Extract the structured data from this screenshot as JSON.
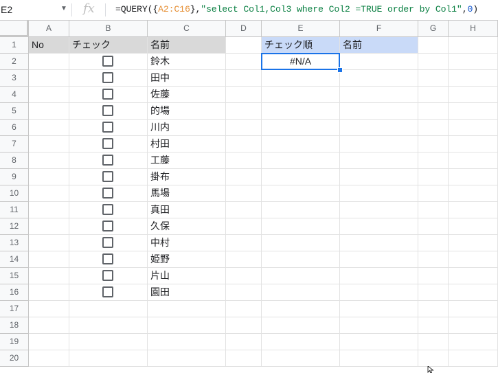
{
  "formula_bar": {
    "name_box": "E2",
    "fx_label": "fx",
    "formula": {
      "prefix": "=QUERY({",
      "range": "A2:C16",
      "mid": "},",
      "query": "\"select Col1,Col3 where Col2 =TRUE order by Col1\"",
      "comma": ",",
      "headers_arg": "0",
      "suffix": ")"
    }
  },
  "columns": [
    "A",
    "B",
    "C",
    "D",
    "E",
    "F",
    "G",
    "H"
  ],
  "rows": [
    "1",
    "2",
    "3",
    "4",
    "5",
    "6",
    "7",
    "8",
    "9",
    "10",
    "11",
    "12",
    "13",
    "14",
    "15",
    "16",
    "17",
    "18",
    "19",
    "20"
  ],
  "header_row": {
    "a1": "No",
    "b1": "チェック",
    "c1": "名前",
    "e1": "チェック順",
    "f1": "名前"
  },
  "names": [
    "鈴木",
    "田中",
    "佐藤",
    "的場",
    "川内",
    "村田",
    "工藤",
    "掛布",
    "馬場",
    "真田",
    "久保",
    "中村",
    "姫野",
    "片山",
    "園田"
  ],
  "checkboxes": [
    false,
    false,
    false,
    false,
    false,
    false,
    false,
    false,
    false,
    false,
    false,
    false,
    false,
    false,
    false
  ],
  "result_cell": {
    "e2": "#N/A"
  },
  "colors": {
    "header_gray": "#d9d9d9",
    "header_blue": "#c9daf8",
    "selection": "#1a73e8",
    "range_ref": "#e69138",
    "string_literal": "#0b8043",
    "number_literal": "#1155cc"
  }
}
